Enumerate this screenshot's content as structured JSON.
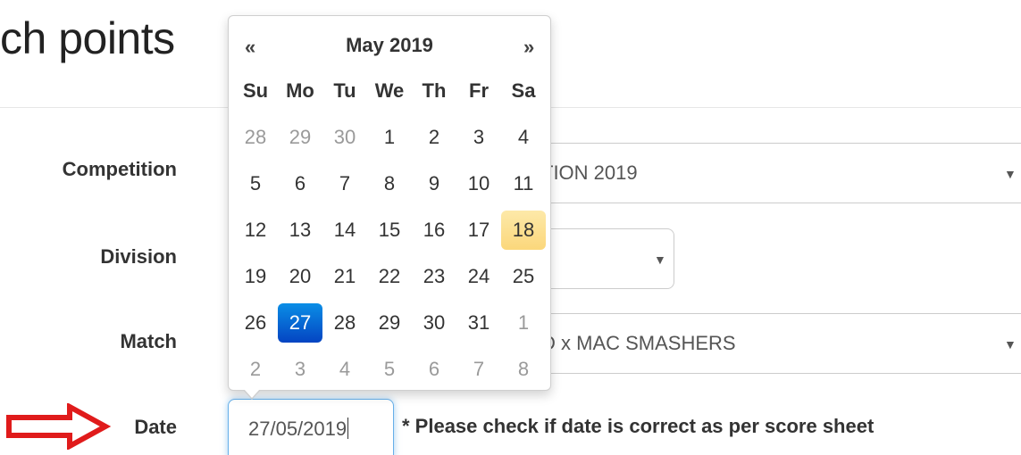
{
  "page": {
    "title": "ch points"
  },
  "form": {
    "competition": {
      "label": "Competition",
      "value": "TION 2019"
    },
    "division": {
      "label": "Division",
      "value": ""
    },
    "match": {
      "label": "Match",
      "value": "D x MAC SMASHERS"
    },
    "date": {
      "label": "Date",
      "value": "27/05/2019",
      "note": "* Please check if date is correct as per score sheet"
    }
  },
  "datepicker": {
    "prev": "«",
    "next": "»",
    "month_year": "May 2019",
    "weekdays": [
      "Su",
      "Mo",
      "Tu",
      "We",
      "Th",
      "Fr",
      "Sa"
    ],
    "weeks": [
      [
        "28",
        "29",
        "30",
        "1",
        "2",
        "3",
        "4"
      ],
      [
        "5",
        "6",
        "7",
        "8",
        "9",
        "10",
        "11"
      ],
      [
        "12",
        "13",
        "14",
        "15",
        "16",
        "17",
        "18"
      ],
      [
        "19",
        "20",
        "21",
        "22",
        "23",
        "24",
        "25"
      ],
      [
        "26",
        "27",
        "28",
        "29",
        "30",
        "31",
        "1"
      ],
      [
        "2",
        "3",
        "4",
        "5",
        "6",
        "7",
        "8"
      ]
    ],
    "muted_cells": [
      "0-0",
      "0-1",
      "0-2",
      "4-6",
      "5-0",
      "5-1",
      "5-2",
      "5-3",
      "5-4",
      "5-5",
      "5-6"
    ],
    "today_cell": "2-6",
    "active_cell": "4-1"
  },
  "icons": {
    "caret": "caret-down-icon",
    "arrow": "red-arrow-icon"
  },
  "colors": {
    "active_day": "#0444c2",
    "today_highlight": "#fbd77b",
    "focus_border": "#66afe9",
    "arrow_red": "#e01b1b"
  }
}
